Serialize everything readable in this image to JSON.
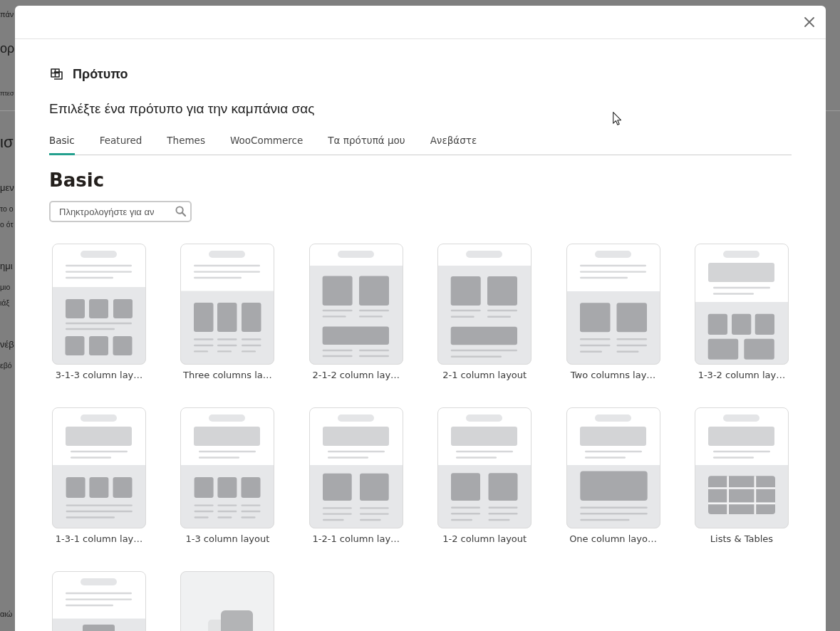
{
  "background_page": {
    "breadcrumb": "πάν",
    "title": "ορ",
    "tab": "πτεσ",
    "heading": "ισ",
    "sections": [
      {
        "title": "μεν",
        "lines": [
          "το ο",
          "ο ότ"
        ]
      },
      {
        "title": "ημι",
        "lines": [
          "μιο",
          "ιάξ"
        ]
      },
      {
        "title": "νέβ",
        "lines": [
          "εβό"
        ]
      }
    ],
    "footer": "αιώ"
  },
  "dialog": {
    "title": "Πρότυπο",
    "subtitle": "Επιλέξτε ένα πρότυπο για την καμπάνια σας",
    "tabs": [
      {
        "label": "Basic",
        "selected": true
      },
      {
        "label": "Featured",
        "selected": false
      },
      {
        "label": "Themes",
        "selected": false
      },
      {
        "label": "WooCommerce",
        "selected": false
      },
      {
        "label": "Τα πρότυπά μου",
        "selected": false
      },
      {
        "label": "Ανεβάστε",
        "selected": false
      }
    ],
    "section_title": "Basic",
    "search": {
      "placeholder": "Πληκτρολογήστε για αν"
    },
    "templates": [
      {
        "label": "3-1-3 column lay…",
        "kind": "c313"
      },
      {
        "label": "Three columns la…",
        "kind": "c3"
      },
      {
        "label": "2-1-2 column lay…",
        "kind": "c212"
      },
      {
        "label": "2-1 column layout",
        "kind": "c21"
      },
      {
        "label": "Two columns lay…",
        "kind": "c2"
      },
      {
        "label": "1-3-2 column lay…",
        "kind": "c132"
      },
      {
        "label": "1-3-1 column lay…",
        "kind": "c131"
      },
      {
        "label": "1-3 column layout",
        "kind": "c13"
      },
      {
        "label": "1-2-1 column lay…",
        "kind": "c121"
      },
      {
        "label": "1-2 column layout",
        "kind": "c12"
      },
      {
        "label": "One column layo…",
        "kind": "c1"
      },
      {
        "label": "Lists & Tables",
        "kind": "table"
      },
      {
        "kind": "single"
      },
      {
        "kind": "blank"
      }
    ]
  }
}
